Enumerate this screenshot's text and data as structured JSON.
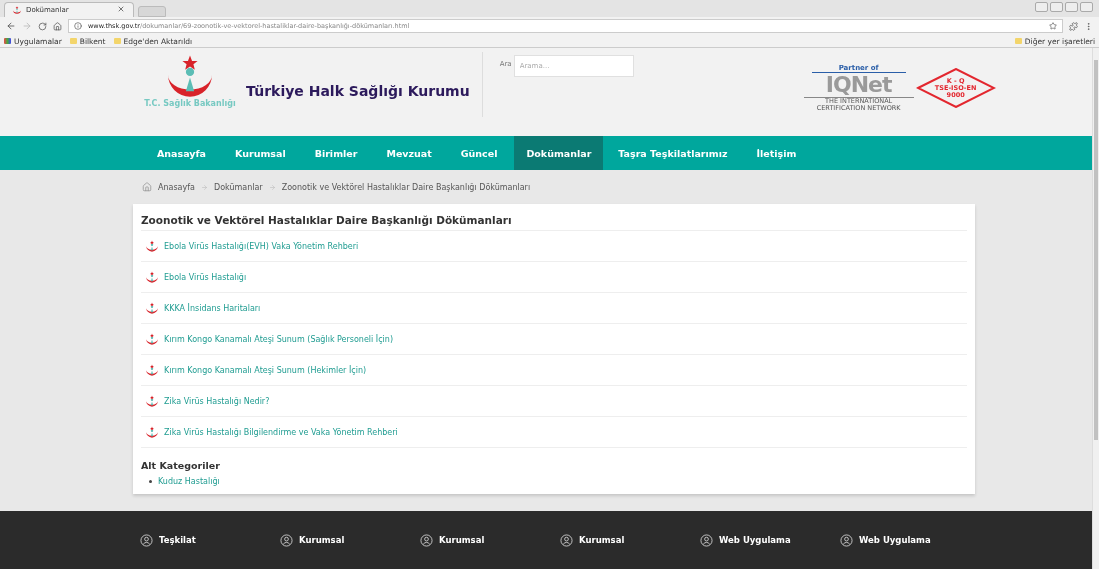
{
  "browser": {
    "tab_title": "Dokümanlar",
    "url_host": "www.thsk.gov.tr",
    "url_path": "/dokumanlar/69-zoonotik-ve-vektorel-hastaliklar-daire-başkanlığı-dökümanları.html",
    "bookmarks": [
      "Uygulamalar",
      "Bilkent",
      "Edge'den Aktarıldı"
    ],
    "other_bookmarks": "Diğer yer işaretleri"
  },
  "header": {
    "ministry": "T.C. Sağlık Bakanlığı",
    "site_title": "Türkiye Halk Sağlığı Kurumu",
    "search_label": "Ara",
    "search_placeholder": "Arama...",
    "partner": {
      "caption": "Partner of",
      "brand": "IQNet",
      "tagline": "THE INTERNATIONAL CERTIFICATION NETWORK",
      "cert": [
        "K - Q",
        "TSE-ISO-EN",
        "9000"
      ]
    }
  },
  "nav": [
    {
      "label": "Anasayfa",
      "selected": false
    },
    {
      "label": "Kurumsal",
      "selected": false
    },
    {
      "label": "Birimler",
      "selected": false
    },
    {
      "label": "Mevzuat",
      "selected": false
    },
    {
      "label": "Güncel",
      "selected": false
    },
    {
      "label": "Dokümanlar",
      "selected": true
    },
    {
      "label": "Taşra Teşkilatlarımız",
      "selected": false
    },
    {
      "label": "İletişim",
      "selected": false
    }
  ],
  "breadcrumb": [
    "Anasayfa",
    "Dokümanlar",
    "Zoonotik ve Vektörel Hastalıklar Daire Başkanlığı Dökümanları"
  ],
  "content": {
    "title": "Zoonotik ve Vektörel Hastalıklar Daire Başkanlığı Dökümanları",
    "documents": [
      "Ebola Virüs Hastalığı(EVH) Vaka Yönetim Rehberi",
      "Ebola Virüs Hastalığı",
      "KKKA İnsidans Haritaları",
      "Kırım Kongo Kanamalı Ateşi Sunum (Sağlık Personeli İçin)",
      "Kırım Kongo Kanamalı Ateşi Sunum (Hekimler İçin)",
      "Zika Virüs Hastalığı Nedir?",
      "Zika Virüs Hastalığı Bilgilendirme ve Vaka Yönetim Rehberi"
    ],
    "subcategories_title": "Alt Kategoriler",
    "subcategories": [
      "Kuduz Hastalığı"
    ]
  },
  "footer": [
    "Teşkilat",
    "Kurumsal",
    "Kurumsal",
    "Kurumsal",
    "Web Uygulama",
    "Web Uygulama"
  ]
}
